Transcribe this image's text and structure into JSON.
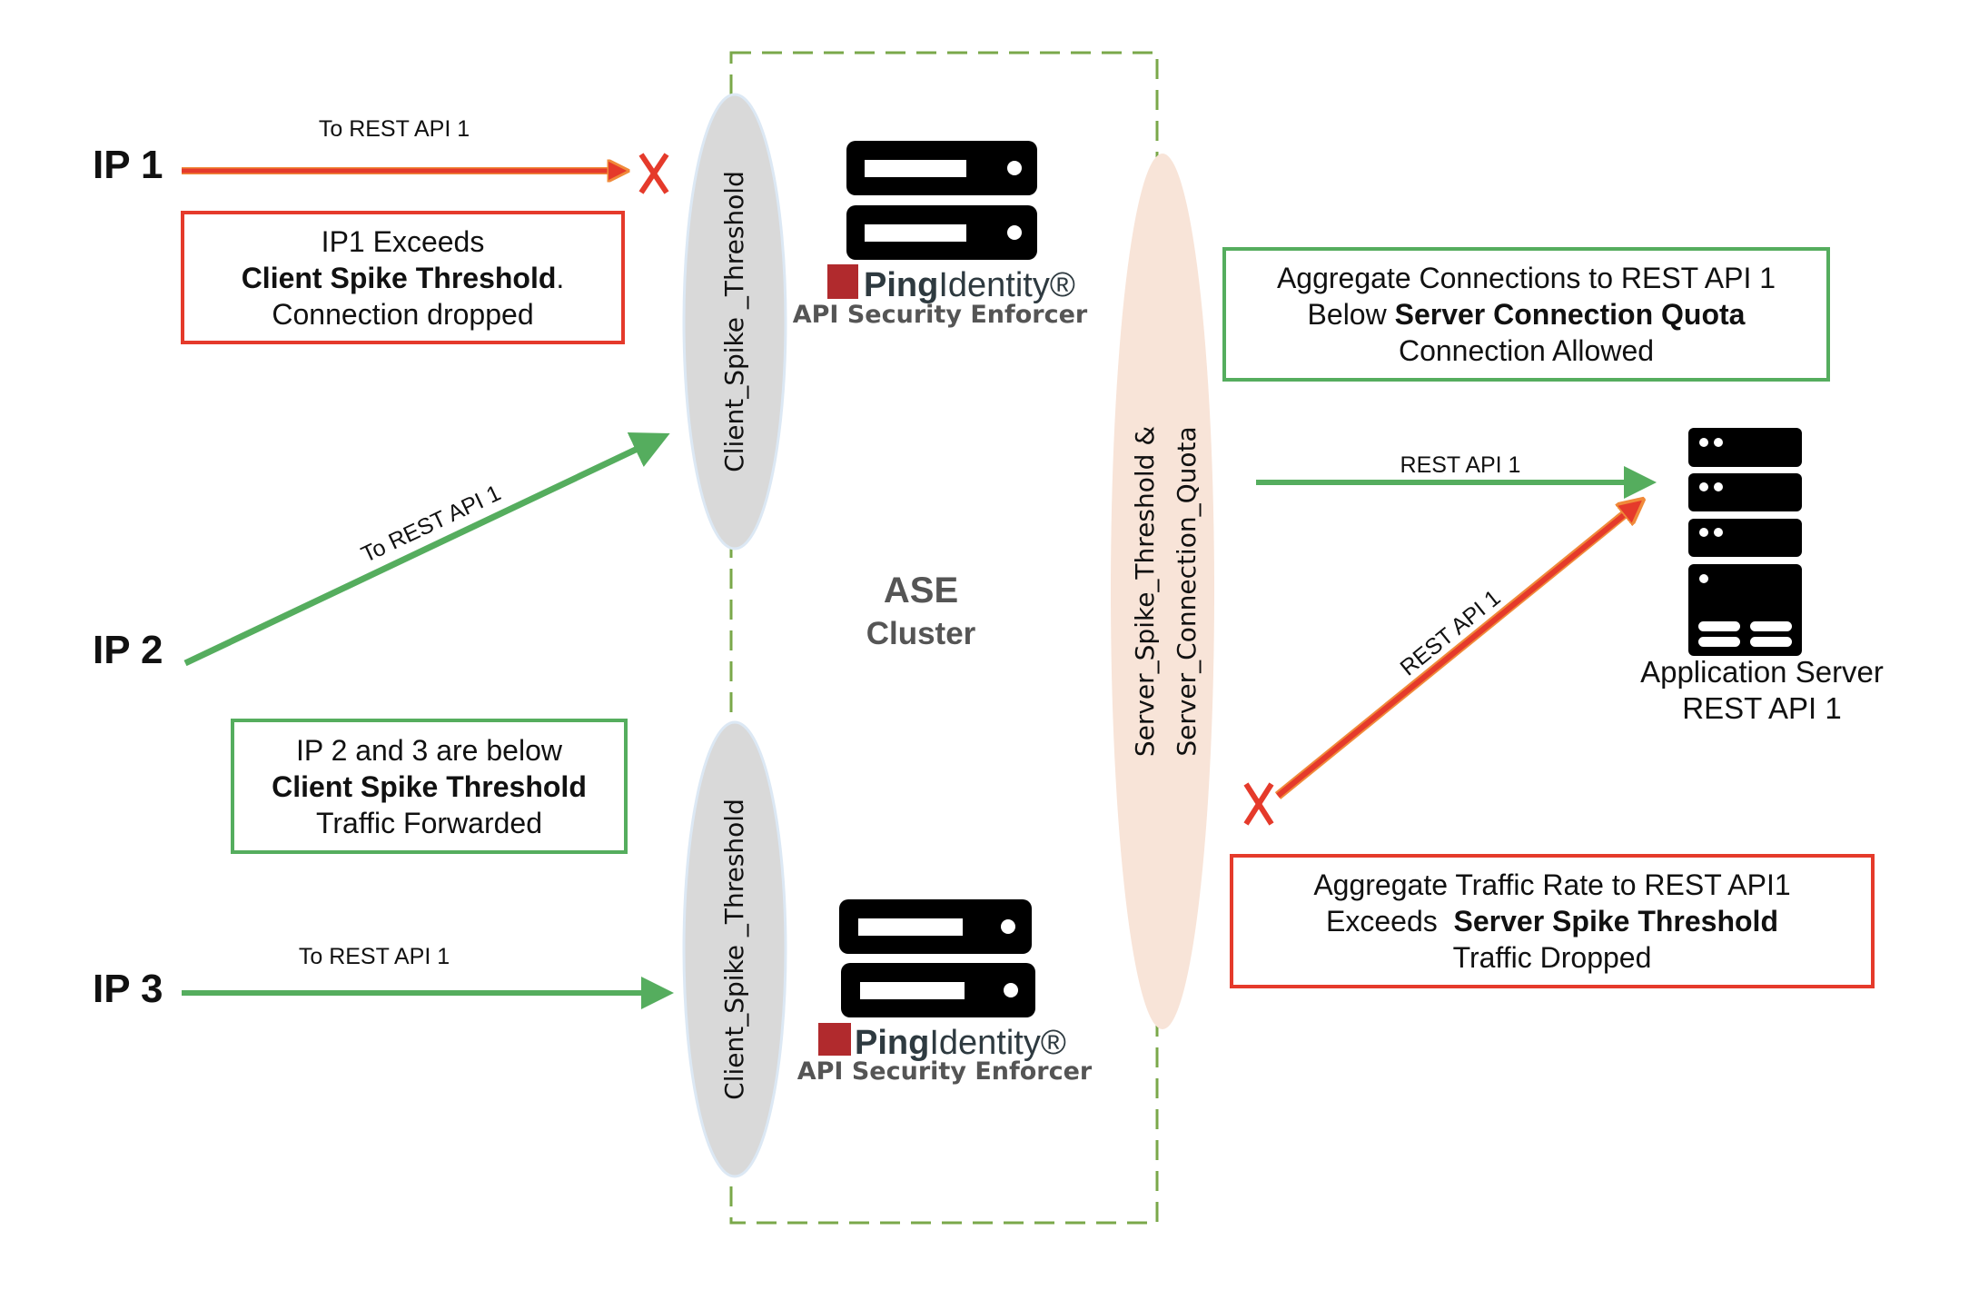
{
  "diagram": {
    "colors": {
      "allowed": "#55ad5e",
      "blocked": "#e53a2b",
      "blocked_outline": "#f08a3a",
      "cluster_border": "#7aa84a",
      "client_ellipse_fill": "#d9d9d9",
      "server_ellipse_fill": "#f8e4d8",
      "ping_red": "#b12a2d"
    },
    "clients": [
      {
        "label": "IP 1",
        "edge_label": "To REST API 1",
        "status": "blocked"
      },
      {
        "label": "IP 2",
        "edge_label": "To REST API 1",
        "status": "allowed"
      },
      {
        "label": "IP 3",
        "edge_label": "To REST API 1",
        "status": "allowed"
      }
    ],
    "notes": {
      "ip1": {
        "line1": "IP1 Exceeds",
        "line2": "Client Spike Threshold",
        "line2_suffix": ".",
        "line3": "Connection dropped"
      },
      "ip23": {
        "line1": "IP 2 and 3 are below",
        "line2": "Client Spike Threshold",
        "line3": "Traffic Forwarded"
      },
      "server_quota": {
        "line1": "Aggregate Connections to REST API 1",
        "line2_prefix": "Below ",
        "line2": "Server Connection Quota",
        "line3": "Connection Allowed"
      },
      "server_spike": {
        "line1": "Aggregate Traffic Rate to REST API1",
        "line2_prefix": "Exceeds  ",
        "line2": "Server Spike Threshold",
        "line3": "Traffic Dropped"
      }
    },
    "client_threshold_label": "Client_Spike _Threshold",
    "client_threshold_label_lower": "Client_Spike _Threshold",
    "server_threshold_label_line1": "Server_Spike_Threshold &",
    "server_threshold_label_line2": "Server_Connection_Quota",
    "cluster": {
      "title": "ASE",
      "subtitle": "Cluster"
    },
    "enforcer": {
      "brand_bold": "Ping",
      "brand_light": "Identity",
      "registered": "®",
      "product": "API Security Enforcer"
    },
    "server_edges": [
      {
        "label": "REST API 1",
        "status": "allowed"
      },
      {
        "label": "REST API 1",
        "status": "blocked"
      }
    ],
    "app_server": {
      "line1": "Application Server",
      "line2": "REST API 1"
    }
  }
}
